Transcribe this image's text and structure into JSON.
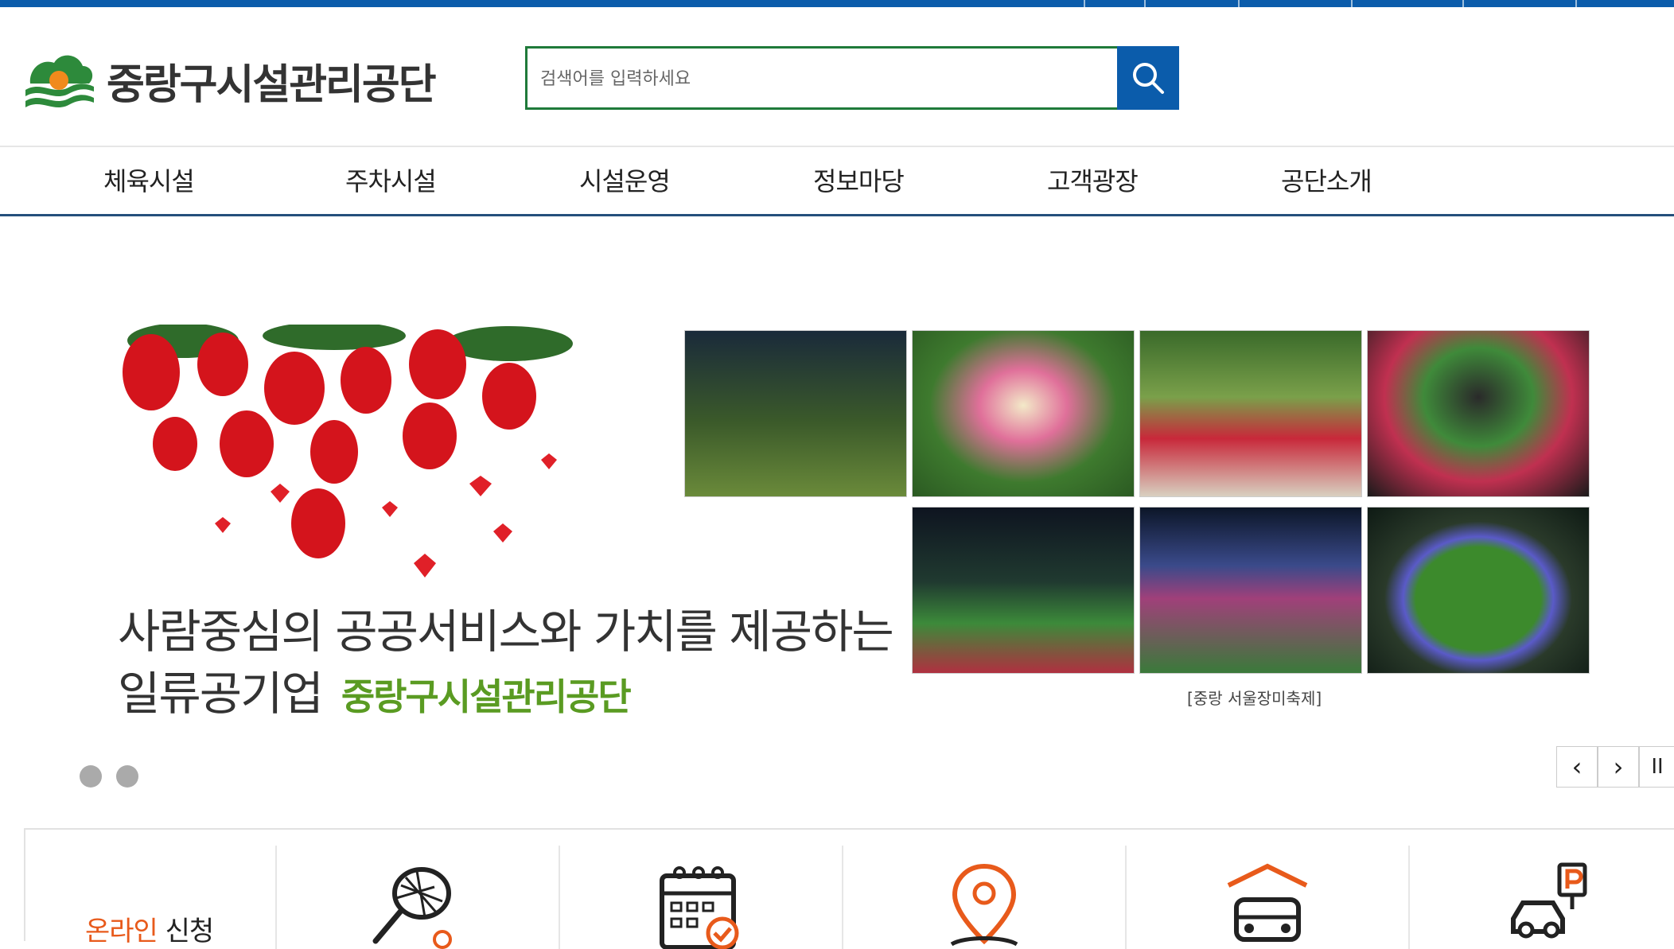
{
  "header": {
    "logo_text": "중랑구시설관리공단",
    "search_placeholder": "검색어를 입력하세요"
  },
  "gnb": {
    "items": [
      "체육시설",
      "주차시설",
      "시설운영",
      "정보마당",
      "고객광장",
      "공단소개"
    ]
  },
  "visual": {
    "slogan_line1": "사람중심의 공공서비스와 가치를 제공하는",
    "slogan_line2": "일류공기업",
    "slogan_org": "중랑구시설관리공단",
    "photo_caption": "[중랑 서울장미축제]",
    "slide_count": 2,
    "controls": {
      "prev": "‹",
      "next": "›",
      "pause": "II"
    }
  },
  "quick": {
    "title_highlight": "온라인",
    "title_rest": " 신청",
    "icons": [
      "tennis-racket-icon",
      "calendar-check-icon",
      "location-pin-icon",
      "parking-garage-icon",
      "car-parking-icon"
    ]
  },
  "colors": {
    "brand_blue": "#0b5cab",
    "search_border_green": "#1f7a3a",
    "slogan_green": "#5a9b22",
    "quick_orange": "#e85a1b"
  }
}
